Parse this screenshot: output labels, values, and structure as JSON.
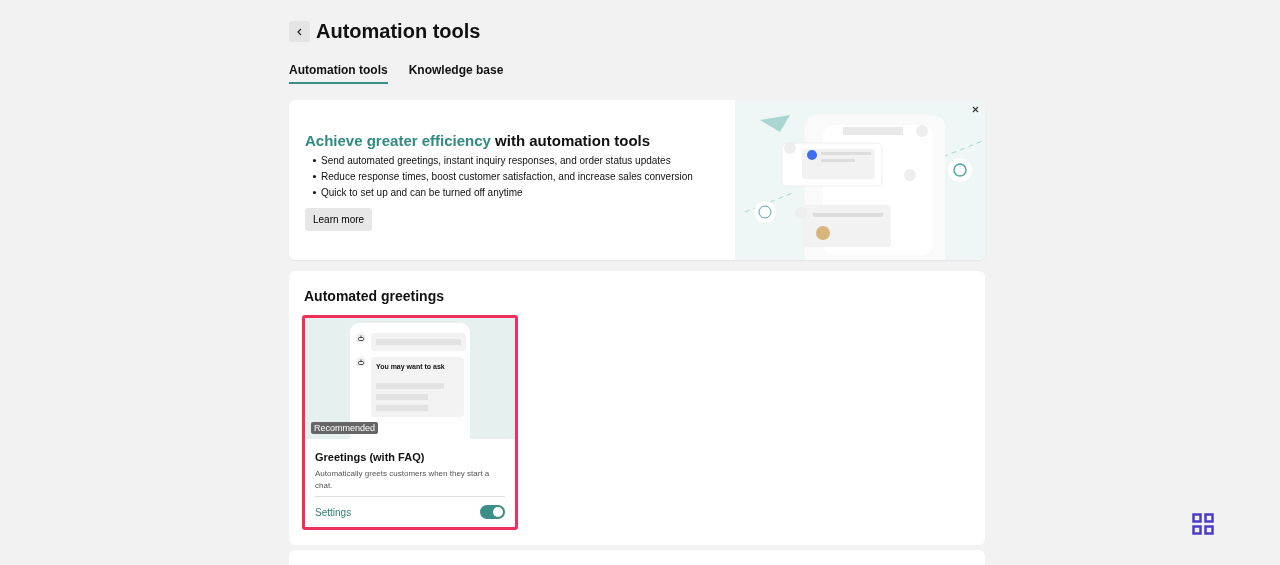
{
  "header": {
    "title": "Automation tools"
  },
  "tabs": [
    {
      "label": "Automation tools",
      "selected": true
    },
    {
      "label": "Knowledge base",
      "selected": false
    }
  ],
  "banner": {
    "headline_highlight": "Achieve greater efficiency",
    "headline_rest": "with automation tools",
    "bullets": [
      "Send automated greetings, instant inquiry responses, and order status updates",
      "Reduce response times, boost customer satisfaction, and increase sales conversion",
      "Quick to set up and can be turned off anytime"
    ],
    "button": "Learn more"
  },
  "greetings": {
    "title": "Automated greetings",
    "cards": [
      {
        "preview_text": "You may want to ask",
        "badge": "Recommended",
        "title": "Greetings (with FAQ)",
        "description": "Automatically greets customers when they start a chat.",
        "link": "Settings",
        "on": true,
        "selected": true
      }
    ]
  }
}
